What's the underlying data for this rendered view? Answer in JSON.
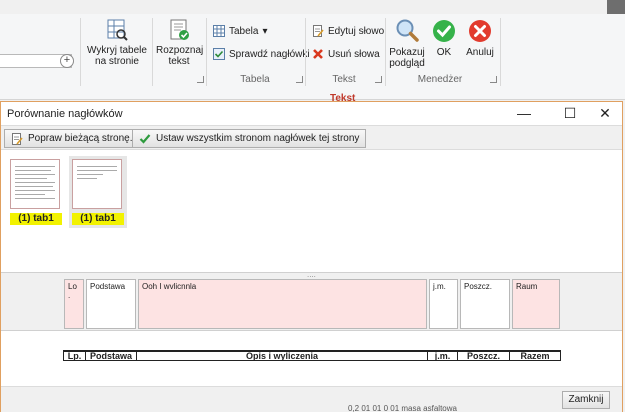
{
  "ribbon": {
    "detect_tables": "Wykryj tabele na stronie",
    "recognize_text": "Rozpoznaj tekst",
    "table_menu": "Tabela",
    "table_menu_arrow": "▾",
    "check_headers": "Sprawdź nagłówki",
    "group_table": "Tabela",
    "edit_word": "Edytuj słowo",
    "delete_words": "Usuń słowa",
    "group_text": "Tekst",
    "show_preview": "Pokazuj podgląd",
    "ok": "OK",
    "cancel": "Anuluj",
    "group_manager": "Menedżer",
    "context_tab": "Tekst",
    "plus": "+"
  },
  "dialog": {
    "title": "Porównanie nagłówków",
    "minimize": "—",
    "maximize": "☐",
    "close": "✕",
    "fix_current_page": "Popraw bieżącą stronę...",
    "set_all_pages": "Ustaw wszystkim stronom nagłówek tej strony",
    "thumbs": [
      "(1) tab1",
      "(1) tab1"
    ],
    "splitter_grip": "....",
    "cells": [
      "Lo .",
      "Podstawa",
      "Ooh I wvlicnnla",
      "j.m.",
      "Poszcz.",
      "Raum"
    ],
    "preview_headers": [
      "Lp.",
      "Podstawa",
      "Opis i wyliczenia",
      "j.m.",
      "Poszcz.",
      "Razem"
    ],
    "close_button": "Zamknij",
    "background_text": "0,2 01 01 0 01    masa  asfaltowa"
  },
  "colors": {
    "pink_cell": "#fde3e3",
    "thumb_caption": "#f2f200",
    "context_tab": "#c0392b",
    "dialog_border": "#e0a060"
  }
}
